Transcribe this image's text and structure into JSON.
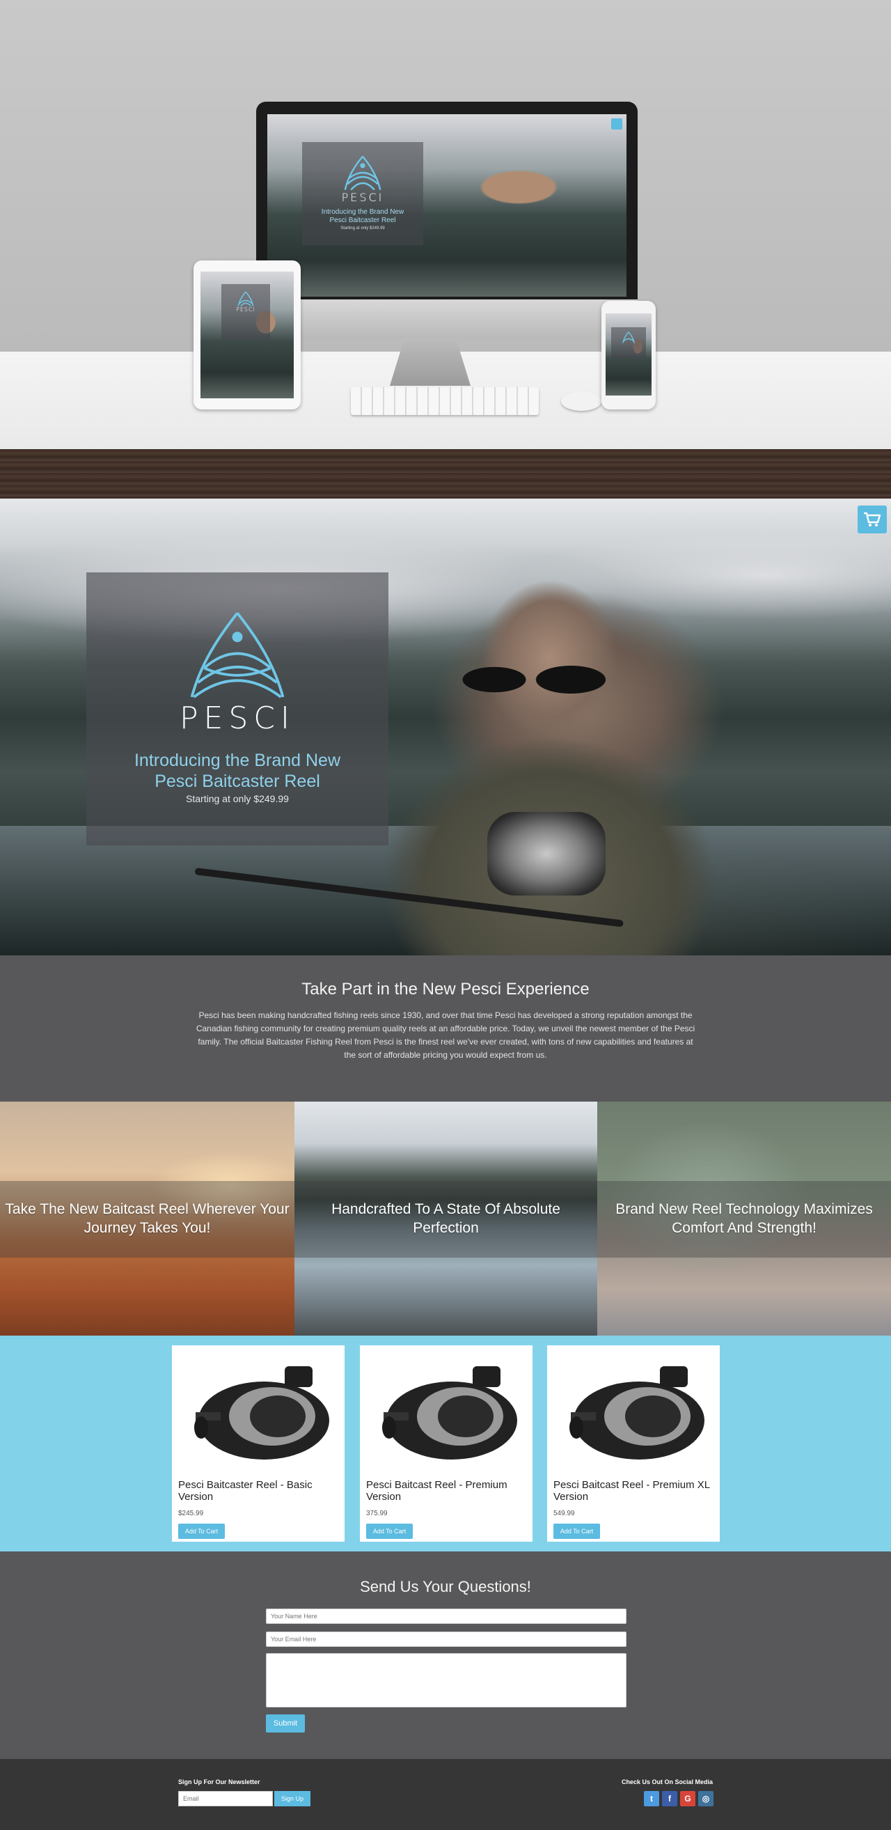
{
  "brand": {
    "name": "PESCI",
    "accent_color": "#5cbbe0",
    "logo_color": "#6fc6e6"
  },
  "mockup": {
    "screen_headline": "Introducing the Brand New Pesci Baitcaster Reel",
    "screen_price": "Starting at only $249.99"
  },
  "hero": {
    "headline_line1": "Introducing the Brand New",
    "headline_line2": "Pesci Baitcaster Reel",
    "price_text": "Starting at only $249.99",
    "cart_icon": "shopping-cart-icon"
  },
  "intro": {
    "title": "Take Part in the New Pesci Experience",
    "body": "Pesci has been making handcrafted fishing reels since 1930, and over that time Pesci has developed a strong reputation amongst the Canadian fishing community for creating premium quality reels at an affordable price. Today, we unveil the newest member of the Pesci family. The official Baitcaster Fishing Reel from Pesci is the finest reel we've ever created, with tons of new capabilities and features at the sort of affordable pricing you would expect from us."
  },
  "features": [
    {
      "text": "Take The New Baitcast Reel Wherever Your Journey Takes You!"
    },
    {
      "text": "Handcrafted To A State Of Absolute Perfection"
    },
    {
      "text": "Brand New Reel Technology Maximizes Comfort And Strength!"
    }
  ],
  "products": [
    {
      "name": "Pesci Baitcaster Reel - Basic Version",
      "price": "$245.99",
      "button": "Add To Cart"
    },
    {
      "name": "Pesci Baitcast Reel - Premium Version",
      "price": "375.99",
      "button": "Add To Cart"
    },
    {
      "name": "Pesci Baitcast Reel - Premium XL Version",
      "price": "549.99",
      "button": "Add To Cart"
    }
  ],
  "contact": {
    "title": "Send Us Your Questions!",
    "name_placeholder": "Your Name Here",
    "email_placeholder": "Your Email Here",
    "submit_label": "Submit"
  },
  "footer": {
    "newsletter_title": "Sign Up For Our Newsletter",
    "email_placeholder": "Email",
    "signup_label": "Sign Up",
    "social_title": "Check Us Out On Social Media",
    "social": [
      {
        "icon": "twitter-icon",
        "glyph": "t",
        "color": "#4c9be0"
      },
      {
        "icon": "facebook-icon",
        "glyph": "f",
        "color": "#3b5ea8"
      },
      {
        "icon": "google-plus-icon",
        "glyph": "G",
        "color": "#d7453a"
      },
      {
        "icon": "instagram-icon",
        "glyph": "◎",
        "color": "#3f729b"
      }
    ]
  }
}
